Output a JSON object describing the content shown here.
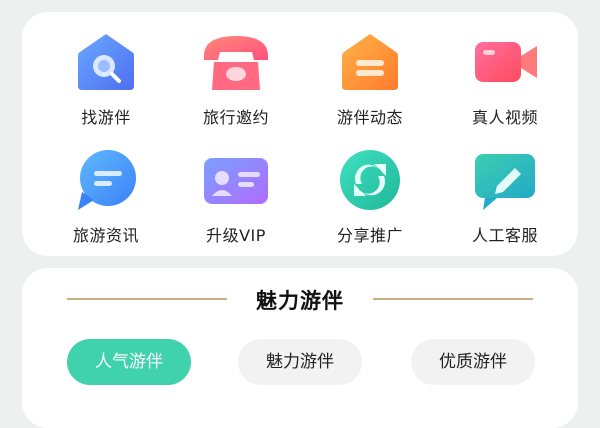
{
  "menu": {
    "items": [
      {
        "label": "找游伴",
        "icon": "house-search-icon"
      },
      {
        "label": "旅行邀约",
        "icon": "telephone-icon"
      },
      {
        "label": "游伴动态",
        "icon": "house-card-icon"
      },
      {
        "label": "真人视频",
        "icon": "video-camera-icon"
      },
      {
        "label": "旅游资讯",
        "icon": "chat-bubble-icon"
      },
      {
        "label": "升级VIP",
        "icon": "id-card-icon"
      },
      {
        "label": "分享推广",
        "icon": "share-refresh-icon"
      },
      {
        "label": "人工客服",
        "icon": "edit-message-icon"
      }
    ]
  },
  "section": {
    "title": "魅力游伴",
    "tabs": [
      {
        "label": "人气游伴",
        "active": true
      },
      {
        "label": "魅力游伴",
        "active": false
      },
      {
        "label": "优质游伴",
        "active": false
      }
    ]
  },
  "colors": {
    "accent": "#40d2ad",
    "divider": "#c8ae86",
    "background": "#eef0f0"
  }
}
